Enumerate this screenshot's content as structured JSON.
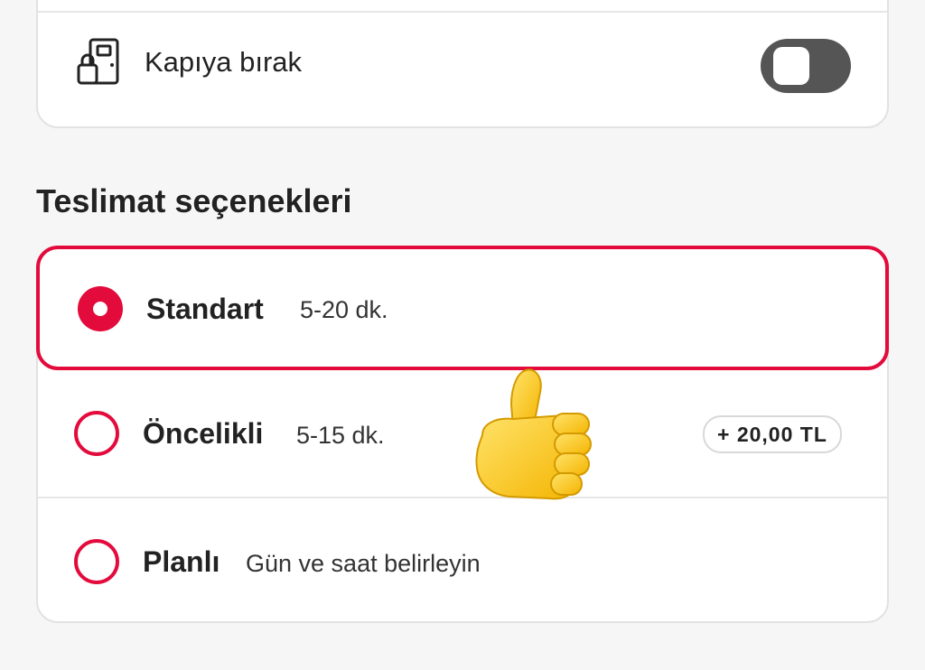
{
  "leave_at_door": {
    "icon": "door-package-icon",
    "label": "Kapıya bırak",
    "toggle_on": false
  },
  "delivery_options": {
    "title": "Teslimat seçenekleri",
    "items": [
      {
        "name": "Standart",
        "detail": "5-20 dk.",
        "selected": true,
        "fee": ""
      },
      {
        "name": "Öncelikli",
        "detail": "5-15 dk.",
        "selected": false,
        "fee": "+ 20,00 TL"
      },
      {
        "name": "Planlı",
        "detail": "Gün ve saat belirleyin",
        "selected": false,
        "fee": ""
      }
    ]
  },
  "overlay": {
    "icon": "thumbs-up-emoji-icon"
  },
  "colors": {
    "accent": "#e30a3c",
    "toggle_off": "#555555",
    "background": "#f6f6f6"
  }
}
